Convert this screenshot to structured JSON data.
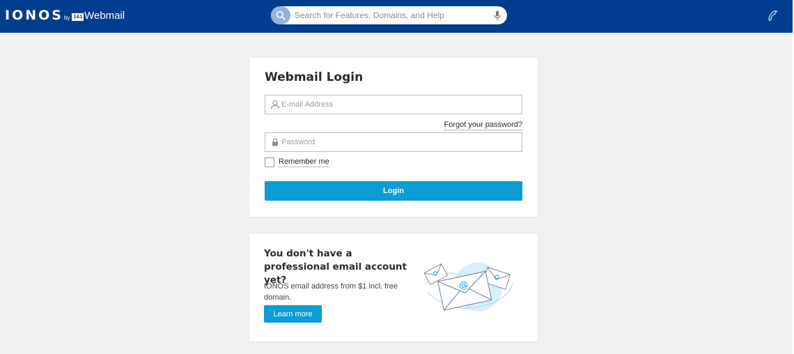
{
  "header": {
    "brand": "IONOS",
    "brand_by": "by",
    "brand_badge": "1&1",
    "app_title": "Webmail",
    "search_placeholder": "Search for Features, Domains, and Help",
    "icons": {
      "search": "search-icon",
      "mic": "microphone-icon",
      "phone": "phone-icon"
    }
  },
  "login": {
    "title": "Webmail Login",
    "email_placeholder": "E-mail Address",
    "email_value": "",
    "password_placeholder": "Password",
    "password_value": "",
    "forgot_label": "Forgot your password?",
    "remember_label": "Remember me",
    "remember_checked": false,
    "login_button": "Login"
  },
  "promo": {
    "title": "You don't have a professional email account yet?",
    "text": "IONOS email address from $1 incl. free domain.",
    "button": "Learn more"
  },
  "colors": {
    "header_bg": "#003d8f",
    "accent": "#0b9dd3",
    "page_bg": "#f0f0f0"
  }
}
